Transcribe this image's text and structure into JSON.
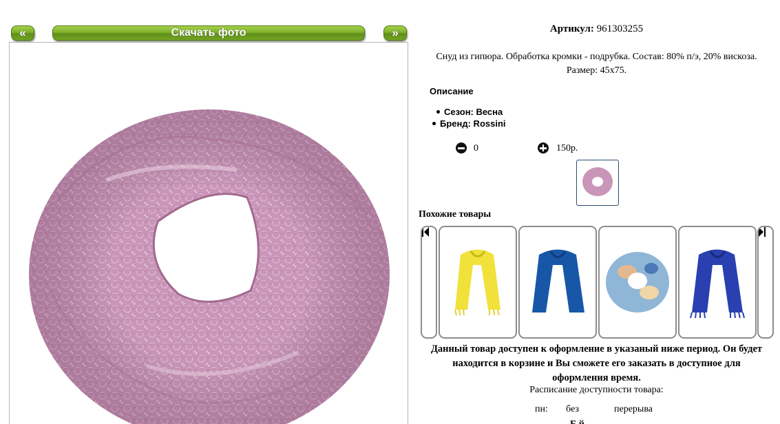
{
  "gallery": {
    "prev_label": "«",
    "next_label": "»",
    "download_label": "Скачать фото"
  },
  "product": {
    "article_label": "Артикул:",
    "article_value": "961303255",
    "description_lines": [
      "Снуд из гипюра. Обработка кромки - подрубка. Состав: 80% п/э, 20% вискоза.",
      "Размер: 45х75."
    ],
    "description_title": "Описание",
    "properties": [
      "Сезон: Весна",
      "Бренд: Rossini"
    ],
    "quantity": "0",
    "price": "150р."
  },
  "similar": {
    "title": "Похожие товары",
    "items": [
      {
        "name": "yellow-scarf",
        "color": "#f0e23a"
      },
      {
        "name": "blue-scarf",
        "color": "#1857a8"
      },
      {
        "name": "patterned-snood",
        "color": "#8fb6d6"
      },
      {
        "name": "royal-blue-scarf",
        "color": "#2a40b0"
      }
    ]
  },
  "availability": {
    "notice_lines": [
      "Данный товар доступен к оформление в указаный ниже период. Он будет",
      "находится в корзине и Вы сможете его заказать в доступное для",
      "оформления время."
    ],
    "schedule_title": "Расписание доступности товара:",
    "schedule": {
      "day": "пн:",
      "time": "без",
      "break": "перерыва"
    },
    "next_line_fragment": "Б й"
  },
  "colors": {
    "accent_green": "#7fb12c",
    "product_pink": "#c995b8"
  }
}
